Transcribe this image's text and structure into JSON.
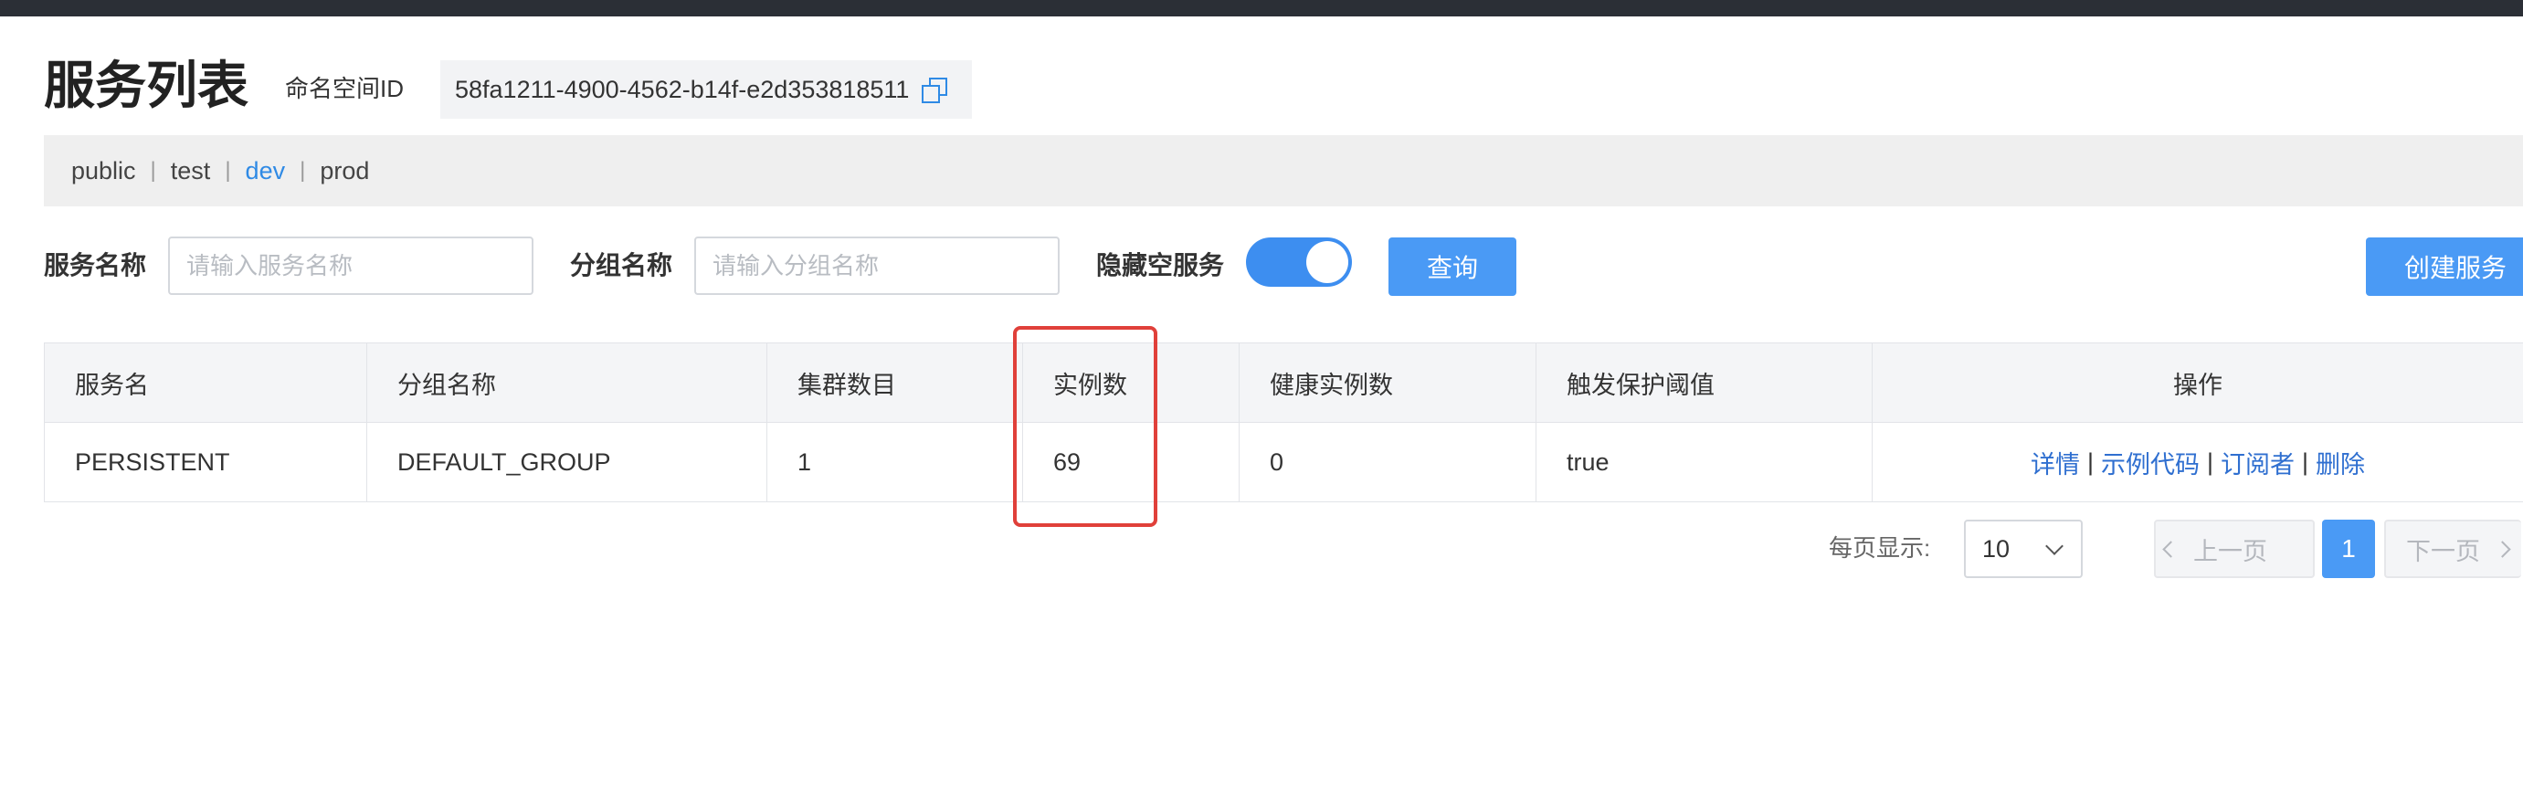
{
  "header": {
    "title": "服务列表",
    "namespace_label": "命名空间ID",
    "namespace_id": "58fa1211-4900-4562-b14f-e2d353818511"
  },
  "namespaces": [
    "public",
    "test",
    "dev",
    "prod"
  ],
  "active_namespace": "dev",
  "filters": {
    "service_name_label": "服务名称",
    "service_name_placeholder": "请输入服务名称",
    "group_name_label": "分组名称",
    "group_name_placeholder": "请输入分组名称",
    "hide_empty_label": "隐藏空服务",
    "hide_empty_enabled": true,
    "query_button": "查询",
    "create_button": "创建服务"
  },
  "table": {
    "columns": [
      "服务名",
      "分组名称",
      "集群数目",
      "实例数",
      "健康实例数",
      "触发保护阈值",
      "操作"
    ],
    "rows": [
      {
        "service_name": "PERSISTENT",
        "group_name": "DEFAULT_GROUP",
        "cluster_count": "1",
        "instance_count": "69",
        "healthy_instance_count": "0",
        "protect_threshold": "true"
      }
    ],
    "operations": [
      "详情",
      "示例代码",
      "订阅者",
      "删除"
    ],
    "operation_separator": "|"
  },
  "pagination": {
    "page_size_label": "每页显示:",
    "page_size": "10",
    "prev_label": "上一页",
    "current_page": "1",
    "next_label": "下一页"
  },
  "colors": {
    "accent": "#4a9af5",
    "link": "#2f6fd0",
    "highlight_border": "#e0403a"
  }
}
